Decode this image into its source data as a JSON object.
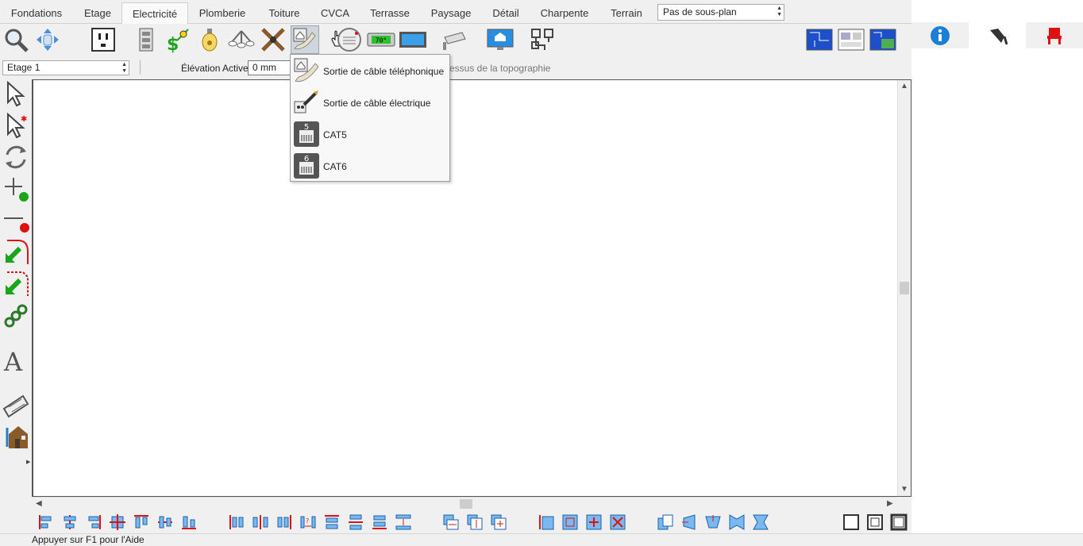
{
  "tabs": [
    "Fondations",
    "Etage",
    "Electricité",
    "Plomberie",
    "Toiture",
    "CVCA",
    "Terrasse",
    "Paysage",
    "Détail",
    "Charpente",
    "Terrain"
  ],
  "active_tab": "Electricité",
  "subplan": {
    "value": "Pas de sous-plan"
  },
  "thermostat_text": "70°",
  "level": {
    "value": "Etage 1"
  },
  "elevation": {
    "label": "Élévation Active:",
    "value": "0 mm"
  },
  "topography_text": "essus de la topographie",
  "menu": {
    "items": [
      {
        "label": "Sortie de câble téléphonique",
        "icon": "phone-jack-icon"
      },
      {
        "label": "Sortie de câble électrique",
        "icon": "cable-outlet-icon"
      },
      {
        "label": "CAT5",
        "icon": "cat5-jack-icon",
        "badge": "5"
      },
      {
        "label": "CAT6",
        "icon": "cat6-jack-icon",
        "badge": "6"
      }
    ]
  },
  "status_text": "Appuyer sur F1 pour l'Aide",
  "colors": {
    "accent_blue": "#1c7fd6",
    "green": "#1aa51a",
    "red": "#e01010",
    "selected_tool": "#cfd6de"
  }
}
